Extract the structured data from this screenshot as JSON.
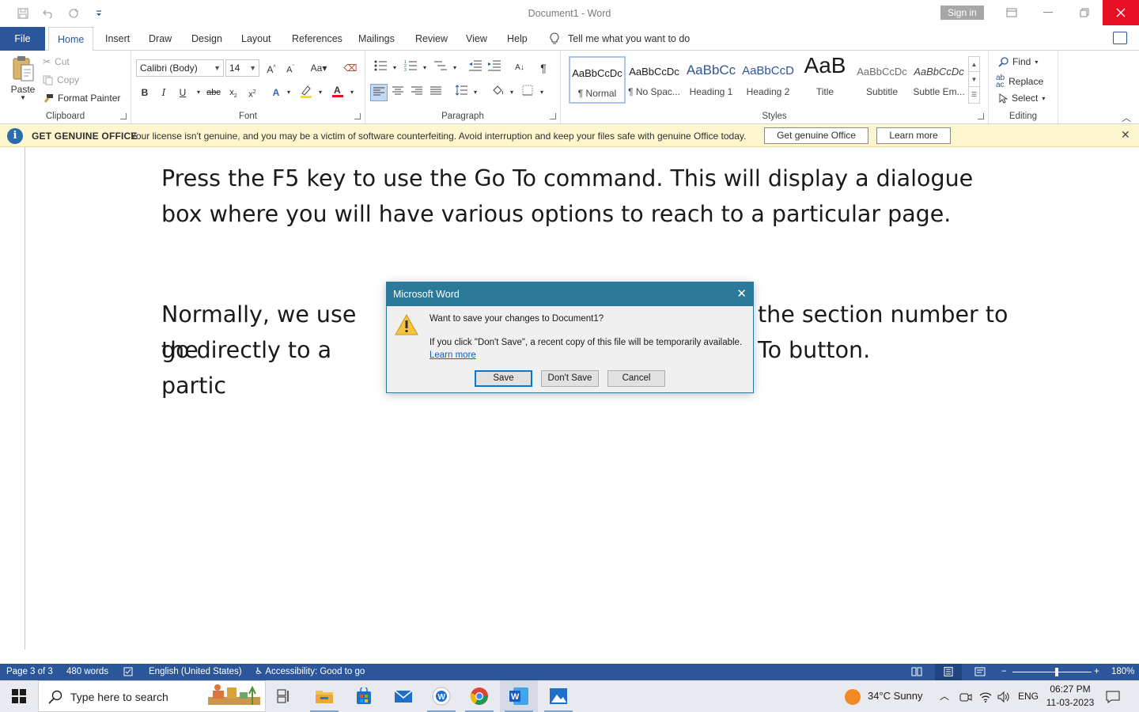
{
  "window": {
    "title": "Document1  -  Word",
    "sign_in": "Sign in"
  },
  "tabs": {
    "file": "File",
    "items": [
      "Home",
      "Insert",
      "Draw",
      "Design",
      "Layout",
      "References",
      "Mailings",
      "Review",
      "View",
      "Help"
    ],
    "active": "Home",
    "tell_me": "Tell me what you want to do"
  },
  "ribbon": {
    "clipboard": {
      "label": "Clipboard",
      "paste": "Paste",
      "cut": "Cut",
      "copy": "Copy",
      "format_painter": "Format Painter"
    },
    "font": {
      "label": "Font",
      "font_name": "Calibri (Body)",
      "font_size": "14"
    },
    "paragraph": {
      "label": "Paragraph"
    },
    "styles": {
      "label": "Styles",
      "items": [
        {
          "sample": "AaBbCcDc",
          "name": "¶ Normal"
        },
        {
          "sample": "AaBbCcDc",
          "name": "¶ No Spac..."
        },
        {
          "sample": "AaBbCc",
          "name": "Heading 1"
        },
        {
          "sample": "AaBbCcD",
          "name": "Heading 2"
        },
        {
          "sample": "AaB",
          "name": "Title"
        },
        {
          "sample": "AaBbCcDc",
          "name": "Subtitle"
        },
        {
          "sample": "AaBbCcDc",
          "name": "Subtle Em..."
        }
      ]
    },
    "editing": {
      "label": "Editing",
      "find": "Find",
      "replace": "Replace",
      "select": "Select"
    }
  },
  "banner": {
    "title": "GET GENUINE OFFICE",
    "message": "Your license isn't genuine, and you may be a victim of software counterfeiting. Avoid interruption and keep your files safe with genuine Office today.",
    "btn_genuine": "Get genuine Office",
    "btn_learn": "Learn more"
  },
  "document": {
    "para1": "Press the F5 key to use the Go To command. This will display a dialogue box where you will have various options to reach to a particular page.",
    "para2_left_line1": "Normally, we use the",
    "para2_right_line1": "the section number to",
    "para2_left_line2": "go directly to a partic",
    "para2_right_line2": "To button."
  },
  "dialog": {
    "title": "Microsoft Word",
    "question": "Want to save your changes to Document1?",
    "info": "If you click \"Don't Save\", a recent copy of this file will be temporarily available.",
    "link": "Learn more",
    "save": "Save",
    "dont_save": "Don't Save",
    "cancel": "Cancel"
  },
  "statusbar": {
    "page": "Page 3 of 3",
    "words": "480 words",
    "language": "English (United States)",
    "accessibility": "Accessibility: Good to go",
    "zoom": "180%",
    "zoom_fraction": 0.56
  },
  "taskbar": {
    "search_placeholder": "Type here to search",
    "weather": "34°C  Sunny",
    "lang": "ENG",
    "time": "06:27 PM",
    "date": "11-03-2023"
  },
  "colors": {
    "word_blue": "#2b579a",
    "dialog_title": "#2b7a9a",
    "banner_bg": "#fdf6cf",
    "close_red": "#e81123"
  }
}
